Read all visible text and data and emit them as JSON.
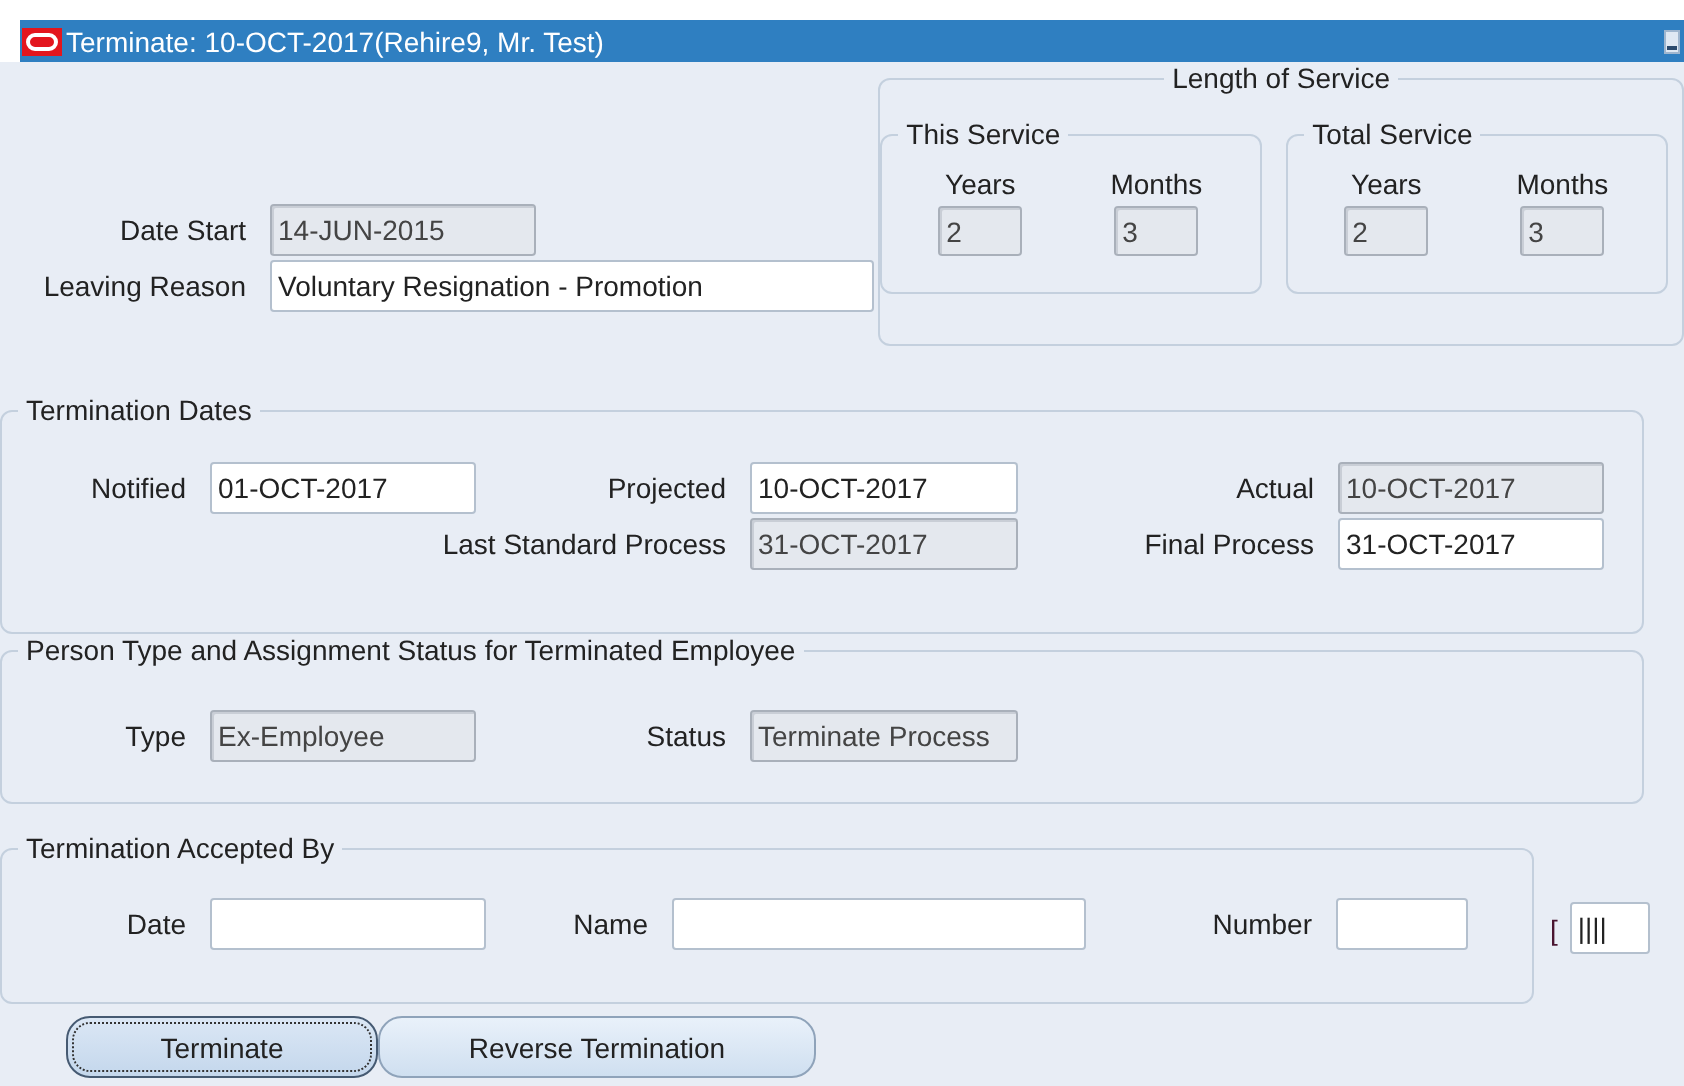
{
  "window": {
    "title": "Terminate: 10-OCT-2017(Rehire9, Mr. Test)"
  },
  "employment": {
    "fields": [
      {
        "label": "Date Start",
        "value": "14-JUN-2015",
        "disabled": true
      },
      {
        "label": "Leaving Reason",
        "value": "Voluntary Resignation - Promotion",
        "disabled": false
      }
    ]
  },
  "length_of_service": {
    "title": "Length of Service",
    "groups": [
      {
        "title": "This Service",
        "fields": [
          {
            "label": "Years",
            "value": "2",
            "disabled": true
          },
          {
            "label": "Months",
            "value": "3",
            "disabled": true
          }
        ]
      },
      {
        "title": "Total Service",
        "fields": [
          {
            "label": "Years",
            "value": "2",
            "disabled": true
          },
          {
            "label": "Months",
            "value": "3",
            "disabled": true
          }
        ]
      }
    ]
  },
  "termination_dates": {
    "title": "Termination Dates",
    "rows": [
      [
        {
          "label": "Notified",
          "value": "01-OCT-2017",
          "disabled": false
        },
        {
          "label": "Projected",
          "value": "10-OCT-2017",
          "disabled": false
        },
        {
          "label": "Actual",
          "value": "10-OCT-2017",
          "disabled": true
        }
      ],
      [
        "",
        {
          "label": "Last Standard Process",
          "value": "31-OCT-2017",
          "disabled": true
        },
        {
          "label": "Final Process",
          "value": "31-OCT-2017",
          "disabled": false
        }
      ]
    ]
  },
  "person_type": {
    "title": "Person Type and Assignment Status for Terminated Employee",
    "fields": [
      {
        "label": "Type",
        "value": "Ex-Employee",
        "disabled": true
      },
      {
        "label": "Status",
        "value": "Terminate Process",
        "disabled": true
      }
    ]
  },
  "accepted_by": {
    "title": "Termination Accepted By",
    "fields": [
      {
        "label": "Date",
        "disabled": false
      },
      {
        "label": "Name",
        "disabled": false
      },
      {
        "label": "Number",
        "disabled": false
      }
    ],
    "extra": {
      "bracket": "[",
      "value": "||||"
    }
  },
  "buttons": [
    {
      "label": "Terminate",
      "selected": true
    },
    {
      "label": "Reverse Termination",
      "selected": false
    }
  ]
}
